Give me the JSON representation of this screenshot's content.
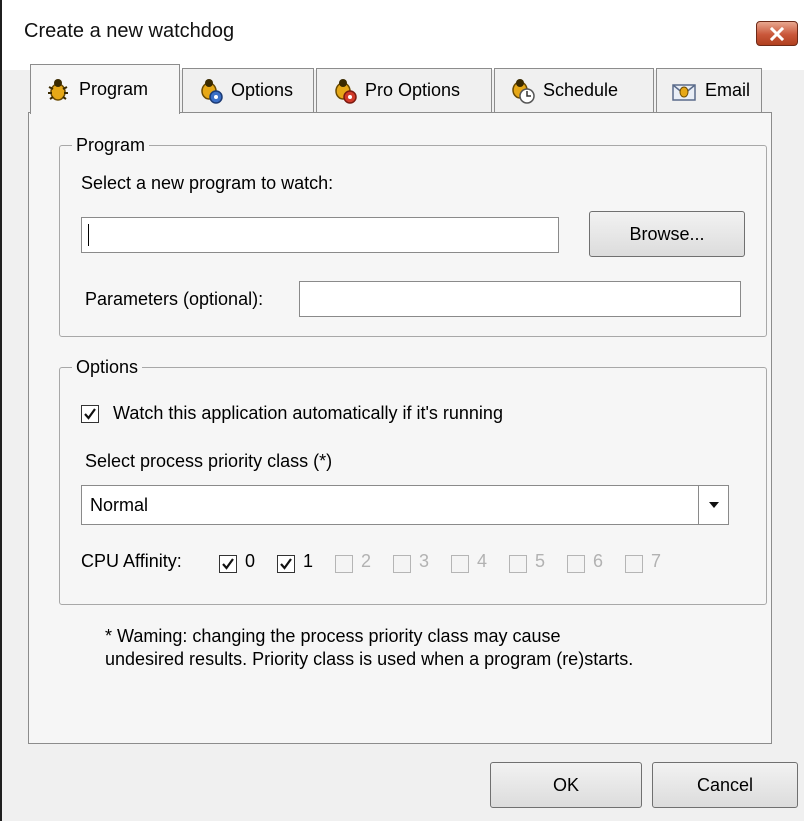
{
  "window": {
    "title": "Create a new watchdog"
  },
  "tabs": [
    {
      "label": "Program",
      "icon": "bug-icon",
      "active": true
    },
    {
      "label": "Options",
      "icon": "gear-bug-icon"
    },
    {
      "label": "Pro Options",
      "icon": "pro-bug-icon"
    },
    {
      "label": "Schedule",
      "icon": "clock-bug-icon"
    },
    {
      "label": "Email",
      "icon": "email-bug-icon"
    }
  ],
  "program_group": {
    "legend": "Program",
    "select_label": "Select a new program to watch:",
    "program_path": "",
    "browse_label": "Browse...",
    "parameters_label": "Parameters (optional):",
    "parameters_value": ""
  },
  "options_group": {
    "legend": "Options",
    "watch_auto_label": "Watch this application automatically if it's running",
    "watch_auto_checked": true,
    "priority_label": "Select process priority class (*)",
    "priority_value": "Normal",
    "affinity_label": "CPU Affinity:",
    "cpus": [
      {
        "label": "0",
        "checked": true,
        "enabled": true
      },
      {
        "label": "1",
        "checked": true,
        "enabled": true
      },
      {
        "label": "2",
        "checked": false,
        "enabled": false
      },
      {
        "label": "3",
        "checked": false,
        "enabled": false
      },
      {
        "label": "4",
        "checked": false,
        "enabled": false
      },
      {
        "label": "5",
        "checked": false,
        "enabled": false
      },
      {
        "label": "6",
        "checked": false,
        "enabled": false
      },
      {
        "label": "7",
        "checked": false,
        "enabled": false
      }
    ]
  },
  "warning": {
    "line1": "* Waming: changing the process priority class may cause",
    "line2": "undesired results. Priority class is used when a program (re)starts."
  },
  "footer": {
    "ok_label": "OK",
    "cancel_label": "Cancel"
  },
  "colors": {
    "close_button": "#c9573a",
    "window_bg": "#f0f0f0",
    "panel_bg": "#f6f6f6"
  }
}
